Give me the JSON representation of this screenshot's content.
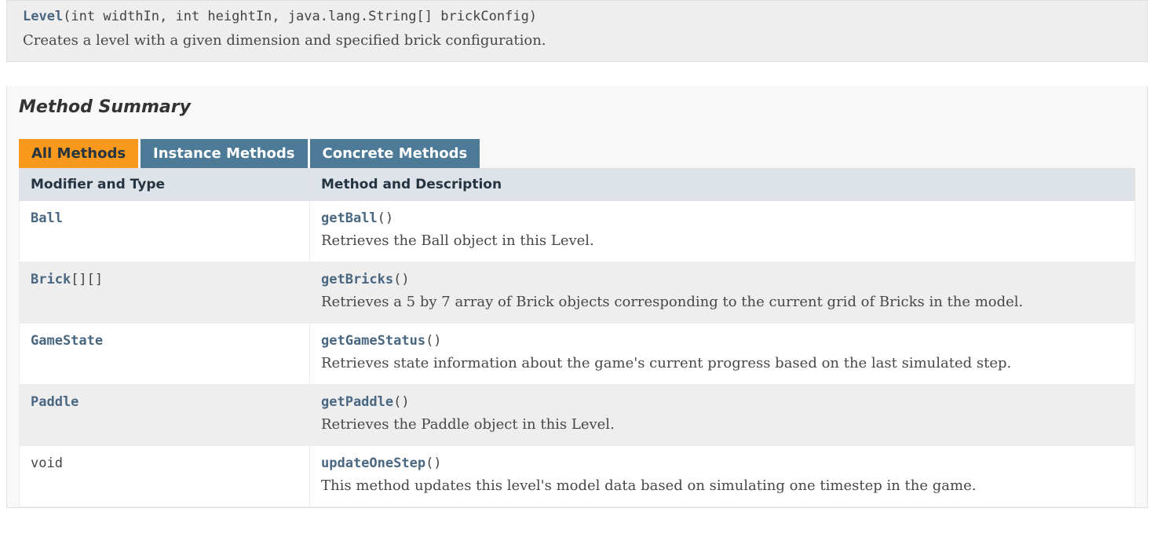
{
  "constructor": {
    "name": "Level",
    "params": "(int widthIn, int heightIn, java.lang.String[] brickConfig)",
    "description": "Creates a level with a given dimension and specified brick configuration."
  },
  "methodSection": {
    "title": "Method Summary",
    "tabs": [
      {
        "label": "All Methods",
        "active": true
      },
      {
        "label": "Instance Methods",
        "active": false
      },
      {
        "label": "Concrete Methods",
        "active": false
      }
    ],
    "headers": {
      "modifier": "Modifier and Type",
      "method": "Method and Description"
    },
    "rows": [
      {
        "typeLink": "Ball",
        "typeSuffix": "",
        "methodName": "getBall",
        "methodParams": "()",
        "description": "Retrieves the Ball object in this Level."
      },
      {
        "typeLink": "Brick",
        "typeSuffix": "[][]",
        "methodName": "getBricks",
        "methodParams": "()",
        "description": "Retrieves a 5 by 7 array of Brick objects corresponding to the current grid of Bricks in the model."
      },
      {
        "typeLink": "GameState",
        "typeSuffix": "",
        "methodName": "getGameStatus",
        "methodParams": "()",
        "description": "Retrieves state information about the game's current progress based on the last simulated step."
      },
      {
        "typeLink": "Paddle",
        "typeSuffix": "",
        "methodName": "getPaddle",
        "methodParams": "()",
        "description": "Retrieves the Paddle object in this Level."
      },
      {
        "typeLink": "",
        "typePlain": "void",
        "typeSuffix": "",
        "methodName": "updateOneStep",
        "methodParams": "()",
        "description": "This method updates this level's model data based on simulating one timestep in the game."
      }
    ]
  }
}
